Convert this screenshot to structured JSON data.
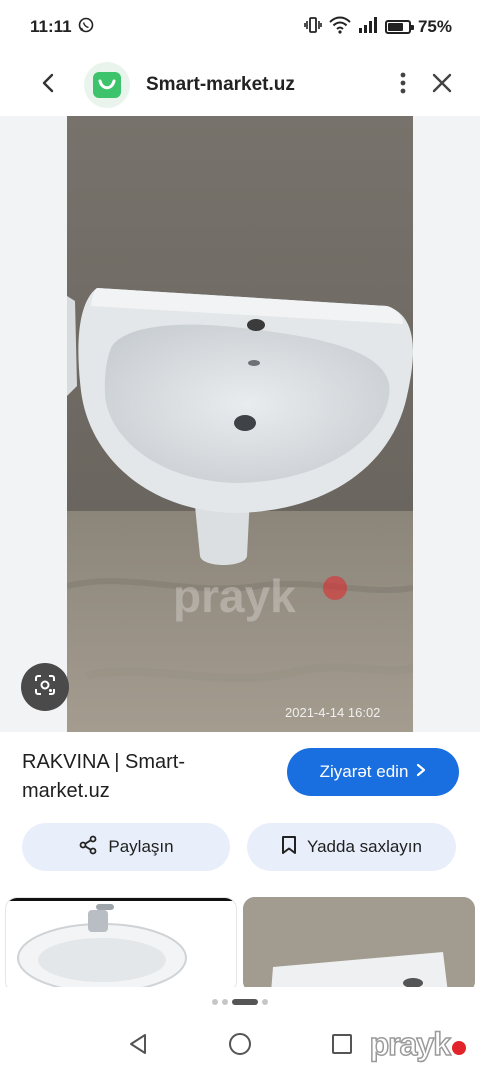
{
  "status_bar": {
    "time": "11:11",
    "battery": "75%",
    "battery_level": 0.75
  },
  "top_bar": {
    "site_title": "Smart-market.uz"
  },
  "image": {
    "timestamp": "2021-4-14 16:02",
    "watermark": "prayk"
  },
  "result": {
    "title": "RAKVINA | Smart-market.uz",
    "visit_label": "Ziyarət edin"
  },
  "actions": {
    "share_label": "Paylaşın",
    "save_label": "Yadda saxlayın"
  },
  "pagination": {
    "count": 4,
    "active_index": 2
  },
  "nav_watermark": "prayk",
  "colors": {
    "accent": "#1a6fe0",
    "action_bg": "#e8effb",
    "logo_green": "#3cc36b",
    "watermark_red": "#e2242a"
  },
  "icons": [
    "whatsapp-icon",
    "vibrate-icon",
    "wifi-icon",
    "signal-icon",
    "battery-icon",
    "back-icon",
    "more-vert-icon",
    "close-icon",
    "lens-icon",
    "share-icon",
    "bookmark-icon",
    "chevron-right-icon"
  ]
}
